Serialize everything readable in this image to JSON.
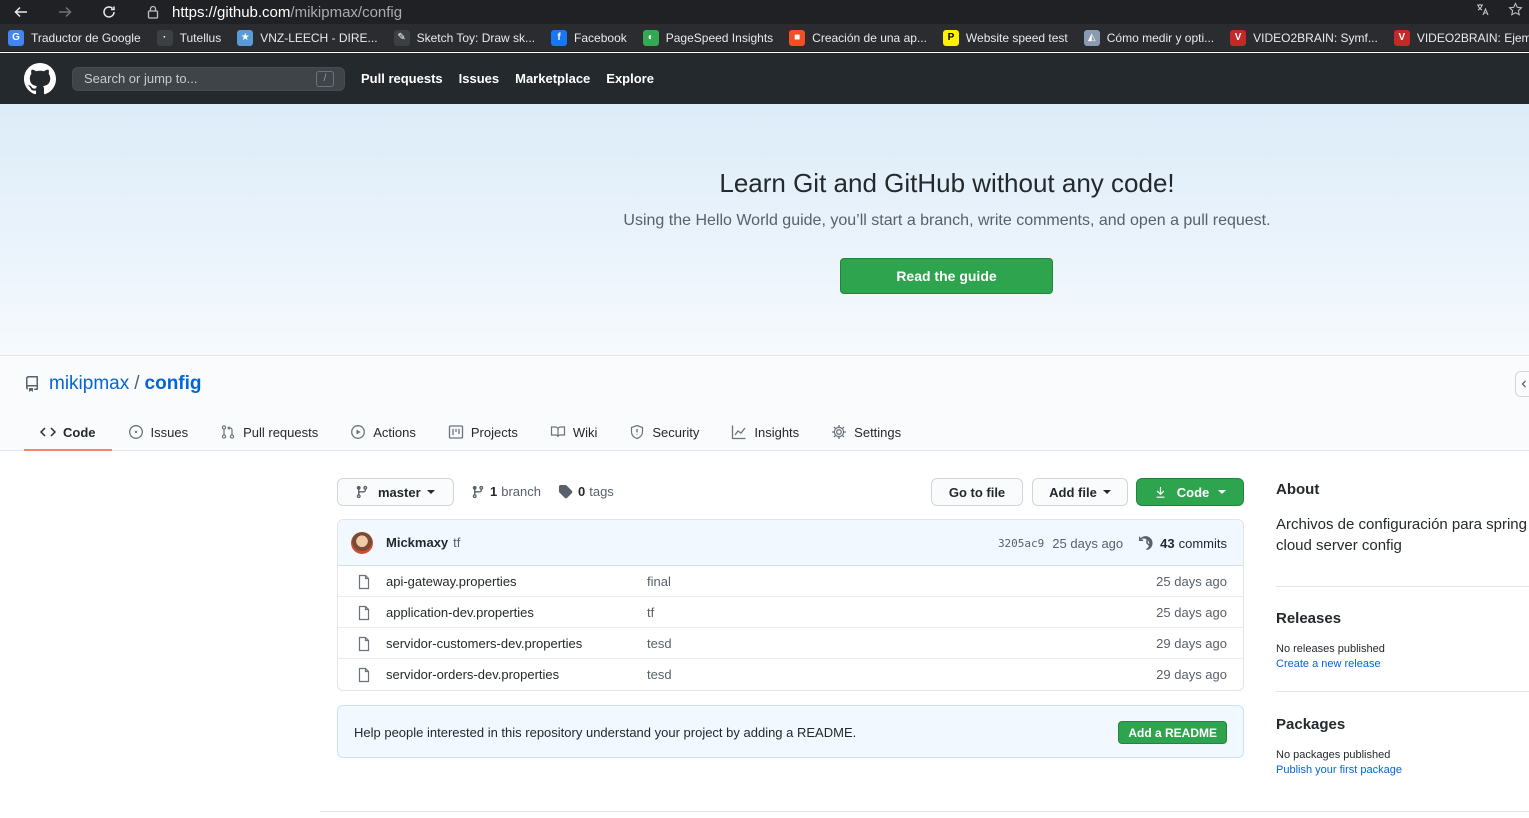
{
  "browser": {
    "url_host": "https://github.com",
    "url_path": "/mikipmax/config",
    "bookmarks": [
      {
        "label": "Traductor de Google",
        "icon": "google-translate-icon",
        "color": "#4285f4",
        "glyph": "G"
      },
      {
        "label": "Tutellus",
        "icon": "tutellus-icon",
        "color": "#3c4043",
        "glyph": "·"
      },
      {
        "label": "VNZ-LEECH - DIRE...",
        "icon": "vnz-leech-icon",
        "color": "#5b9bd5",
        "glyph": "★"
      },
      {
        "label": "Sketch Toy: Draw sk...",
        "icon": "sketch-toy-icon",
        "color": "#3c4043",
        "glyph": "✎"
      },
      {
        "label": "Facebook",
        "icon": "facebook-icon",
        "color": "#1877f2",
        "glyph": "f"
      },
      {
        "label": "PageSpeed Insights",
        "icon": "pagespeed-icon",
        "color": "#34a853",
        "glyph": "◐"
      },
      {
        "label": "Creación de una ap...",
        "icon": "microsoft-icon",
        "color": "#f25022",
        "glyph": "■"
      },
      {
        "label": "Website speed test",
        "icon": "pingdom-icon",
        "color": "#fff200",
        "glyph": "P"
      },
      {
        "label": "Cómo medir y opti...",
        "icon": "article-icon",
        "color": "#8a9bb0",
        "glyph": "◭"
      },
      {
        "label": "VIDEO2BRAIN: Symf...",
        "icon": "video2brain-icon",
        "color": "#c62828",
        "glyph": "V"
      },
      {
        "label": "VIDEO2BRAIN: Ejem...",
        "icon": "video2brain-icon",
        "color": "#c62828",
        "glyph": "V"
      }
    ]
  },
  "header": {
    "search_placeholder": "Search or jump to...",
    "search_key": "/",
    "nav": [
      "Pull requests",
      "Issues",
      "Marketplace",
      "Explore"
    ]
  },
  "hero": {
    "title": "Learn Git and GitHub without any code!",
    "subtitle": "Using the Hello World guide, you’ll start a branch, write comments, and open a pull request.",
    "button": "Read the guide"
  },
  "repo": {
    "owner": "mikipmax",
    "separator": "/",
    "name": "config",
    "tabs": [
      {
        "label": "Code",
        "icon": "code-icon",
        "active": true
      },
      {
        "label": "Issues",
        "icon": "issue-icon"
      },
      {
        "label": "Pull requests",
        "icon": "pull-request-icon"
      },
      {
        "label": "Actions",
        "icon": "play-icon"
      },
      {
        "label": "Projects",
        "icon": "project-icon"
      },
      {
        "label": "Wiki",
        "icon": "book-icon"
      },
      {
        "label": "Security",
        "icon": "shield-icon"
      },
      {
        "label": "Insights",
        "icon": "graph-icon"
      },
      {
        "label": "Settings",
        "icon": "gear-icon"
      }
    ]
  },
  "toolbar": {
    "branch": "master",
    "branch_count": "1",
    "branch_label": "branch",
    "tag_count": "0",
    "tag_label": "tags",
    "go_to_file": "Go to file",
    "add_file": "Add file",
    "code": "Code"
  },
  "commit": {
    "author": "Mickmaxy",
    "message": "tf",
    "sha": "3205ac9",
    "age": "25 days ago",
    "count": "43",
    "count_label": "commits"
  },
  "files": [
    {
      "name": "api-gateway.properties",
      "message": "final",
      "age": "25 days ago"
    },
    {
      "name": "application-dev.properties",
      "message": "tf",
      "age": "25 days ago"
    },
    {
      "name": "servidor-customers-dev.properties",
      "message": "tesd",
      "age": "29 days ago"
    },
    {
      "name": "servidor-orders-dev.properties",
      "message": "tesd",
      "age": "29 days ago"
    }
  ],
  "readme": {
    "text": "Help people interested in this repository understand your project by adding a README.",
    "button": "Add a README"
  },
  "sidebar": {
    "about_title": "About",
    "about_desc": "Archivos de configuración para spring cloud server config",
    "releases_title": "Releases",
    "releases_none": "No releases published",
    "releases_link": "Create a new release",
    "packages_title": "Packages",
    "packages_none": "No packages published",
    "packages_link": "Publish your first package"
  },
  "colors": {
    "accent_green": "#2ea44f",
    "link_blue": "#0366d6",
    "header_dark": "#24292e",
    "tab_underline": "#f9826c"
  }
}
